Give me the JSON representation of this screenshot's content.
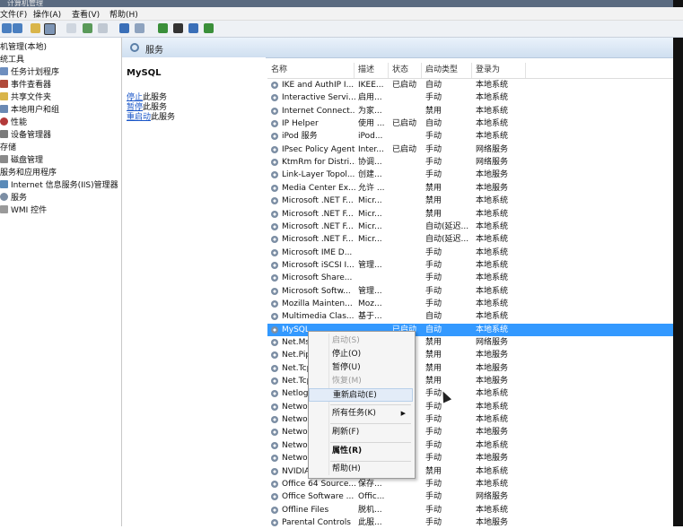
{
  "window": {
    "title": "计算机管理"
  },
  "menu": [
    {
      "label": "文件(F)"
    },
    {
      "label": "操作(A)"
    },
    {
      "label": "查看(V)"
    },
    {
      "label": "帮助(H)"
    }
  ],
  "header": {
    "title": "服务"
  },
  "tree": [
    {
      "label": "机管理(本地)"
    },
    {
      "label": "统工具"
    },
    {
      "label": "任务计划程序"
    },
    {
      "label": "事件查看器"
    },
    {
      "label": "共享文件夹"
    },
    {
      "label": "本地用户和组"
    },
    {
      "label": "性能"
    },
    {
      "label": "设备管理器"
    },
    {
      "label": "存储"
    },
    {
      "label": "磁盘管理"
    },
    {
      "label": "服务和应用程序"
    },
    {
      "label": "Internet 信息服务(IIS)管理器"
    },
    {
      "label": "服务"
    },
    {
      "label": "WMI 控件"
    }
  ],
  "description": {
    "service_name": "MySQL",
    "links": [
      {
        "action": "停止",
        "suffix": "此服务"
      },
      {
        "action": "暂停",
        "suffix": "此服务"
      },
      {
        "action": "重启动",
        "suffix": "此服务"
      }
    ]
  },
  "columns": [
    "名称",
    "描述",
    "状态",
    "启动类型",
    "登录为"
  ],
  "services": [
    {
      "name": "IKE and AuthIP I...",
      "desc": "IKEE...",
      "status": "已启动",
      "startup": "自动",
      "logon": "本地系统"
    },
    {
      "name": "Interactive Servi...",
      "desc": "启用...",
      "status": "",
      "startup": "手动",
      "logon": "本地系统"
    },
    {
      "name": "Internet Connect...",
      "desc": "为家...",
      "status": "",
      "startup": "禁用",
      "logon": "本地系统"
    },
    {
      "name": "IP Helper",
      "desc": "使用 ...",
      "status": "已启动",
      "startup": "自动",
      "logon": "本地系统"
    },
    {
      "name": "iPod 服务",
      "desc": "iPod...",
      "status": "",
      "startup": "手动",
      "logon": "本地系统"
    },
    {
      "name": "IPsec Policy Agent",
      "desc": "Inter...",
      "status": "已启动",
      "startup": "手动",
      "logon": "网络服务"
    },
    {
      "name": "KtmRm for Distri...",
      "desc": "协调...",
      "status": "",
      "startup": "手动",
      "logon": "网络服务"
    },
    {
      "name": "Link-Layer Topol...",
      "desc": "创建...",
      "status": "",
      "startup": "手动",
      "logon": "本地服务"
    },
    {
      "name": "Media Center Ex...",
      "desc": "允许 ...",
      "status": "",
      "startup": "禁用",
      "logon": "本地服务"
    },
    {
      "name": "Microsoft .NET F...",
      "desc": "Micr...",
      "status": "",
      "startup": "禁用",
      "logon": "本地系统"
    },
    {
      "name": "Microsoft .NET F...",
      "desc": "Micr...",
      "status": "",
      "startup": "禁用",
      "logon": "本地系统"
    },
    {
      "name": "Microsoft .NET F...",
      "desc": "Micr...",
      "status": "",
      "startup": "自动(延迟...",
      "logon": "本地系统"
    },
    {
      "name": "Microsoft .NET F...",
      "desc": "Micr...",
      "status": "",
      "startup": "自动(延迟...",
      "logon": "本地系统"
    },
    {
      "name": "Microsoft IME D...",
      "desc": "",
      "status": "",
      "startup": "手动",
      "logon": "本地系统"
    },
    {
      "name": "Microsoft iSCSI I...",
      "desc": "管理...",
      "status": "",
      "startup": "手动",
      "logon": "本地系统"
    },
    {
      "name": "Microsoft Share...",
      "desc": "",
      "status": "",
      "startup": "手动",
      "logon": "本地系统"
    },
    {
      "name": "Microsoft Softw...",
      "desc": "管理...",
      "status": "",
      "startup": "手动",
      "logon": "本地系统"
    },
    {
      "name": "Mozilla Mainten...",
      "desc": "Moz...",
      "status": "",
      "startup": "手动",
      "logon": "本地系统"
    },
    {
      "name": "Multimedia Clas...",
      "desc": "基于...",
      "status": "",
      "startup": "自动",
      "logon": "本地系统"
    },
    {
      "name": "MySQL",
      "desc": "",
      "status": "已启动",
      "startup": "自动",
      "logon": "本地系统"
    },
    {
      "name": "Net.Ms...",
      "desc": "",
      "status": "",
      "startup": "禁用",
      "logon": "网络服务"
    },
    {
      "name": "Net.Pip...",
      "desc": "",
      "status": "",
      "startup": "禁用",
      "logon": "本地服务"
    },
    {
      "name": "Net.Tcp...",
      "desc": "",
      "status": "",
      "startup": "禁用",
      "logon": "本地服务"
    },
    {
      "name": "Net.Tcp...",
      "desc": "",
      "status": "",
      "startup": "禁用",
      "logon": "本地服务"
    },
    {
      "name": "Netlog...",
      "desc": "",
      "status": "",
      "startup": "手动",
      "logon": "本地系统"
    },
    {
      "name": "Netwo...",
      "desc": "",
      "status": "",
      "startup": "手动",
      "logon": "本地系统"
    },
    {
      "name": "Netwo...",
      "desc": "",
      "status": "",
      "startup": "手动",
      "logon": "本地系统"
    },
    {
      "name": "Netwo...",
      "desc": "",
      "status": "",
      "startup": "手动",
      "logon": "本地服务"
    },
    {
      "name": "Netwo...",
      "desc": "",
      "status": "",
      "startup": "手动",
      "logon": "本地系统"
    },
    {
      "name": "Netwo...",
      "desc": "",
      "status": "",
      "startup": "手动",
      "logon": "本地服务"
    },
    {
      "name": "NVIDIA...",
      "desc": "",
      "status": "",
      "startup": "禁用",
      "logon": "本地系统"
    },
    {
      "name": "Office 64 Source...",
      "desc": "保存...",
      "status": "",
      "startup": "手动",
      "logon": "本地系统"
    },
    {
      "name": "Office Software ...",
      "desc": "Offic...",
      "status": "",
      "startup": "手动",
      "logon": "网络服务"
    },
    {
      "name": "Offline Files",
      "desc": "脱机...",
      "status": "",
      "startup": "手动",
      "logon": "本地系统"
    },
    {
      "name": "Parental Controls",
      "desc": "此服...",
      "status": "",
      "startup": "手动",
      "logon": "本地服务"
    }
  ],
  "context_menu": [
    {
      "label": "启动(S)"
    },
    {
      "label": "停止(O)"
    },
    {
      "label": "暂停(U)"
    },
    {
      "label": "恢复(M)"
    },
    {
      "label": "重新启动(E)"
    },
    {
      "label": "所有任务(K)"
    },
    {
      "label": "刷新(F)"
    },
    {
      "label": "属性(R)"
    },
    {
      "label": "帮助(H)"
    }
  ]
}
